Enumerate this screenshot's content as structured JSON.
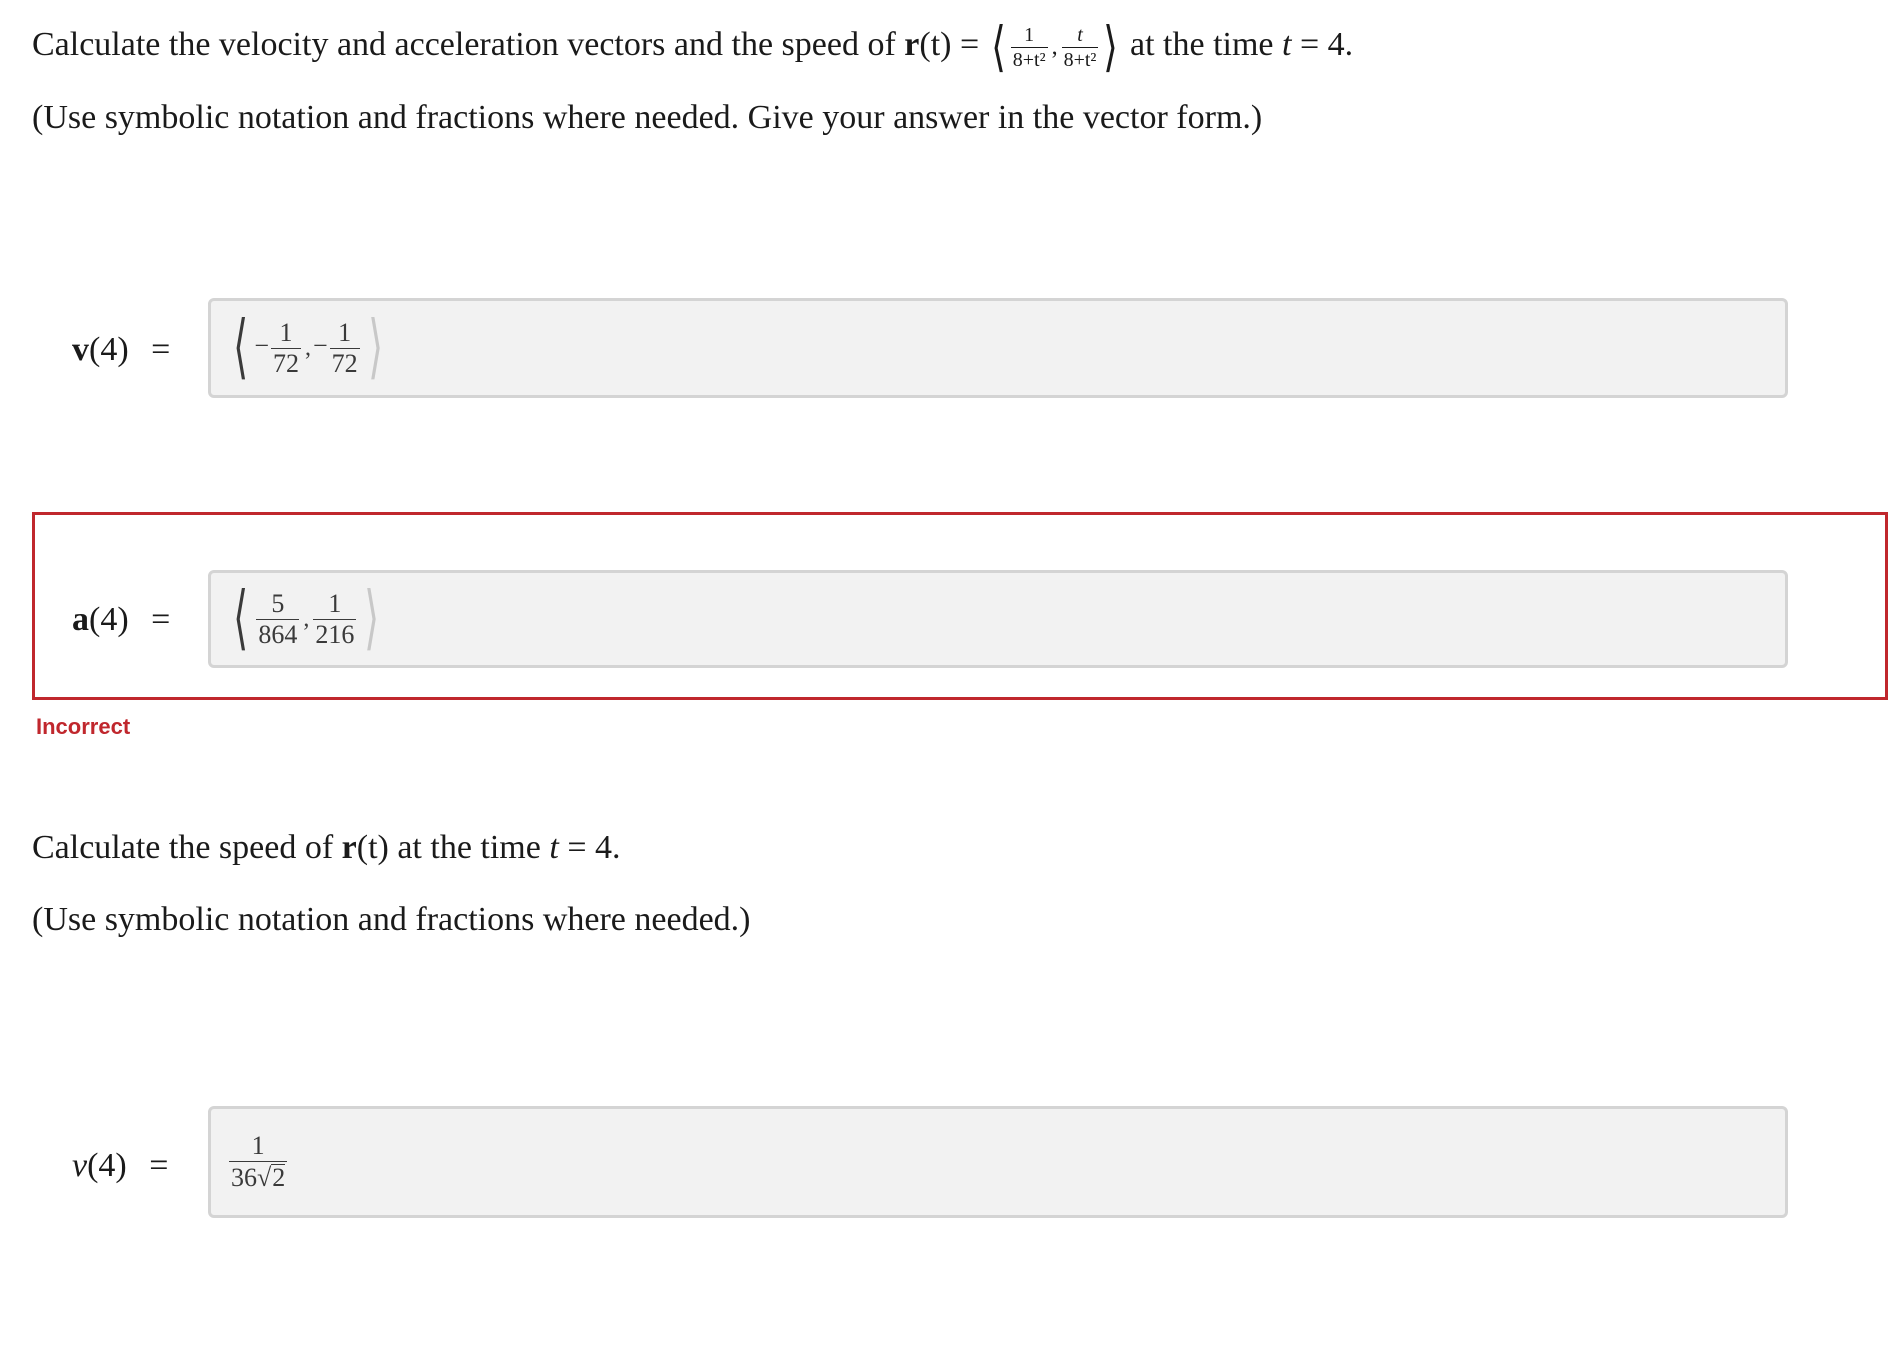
{
  "question1": {
    "prefix": "Calculate the velocity and acceleration vectors and the speed of",
    "r_symbol": "r",
    "r_arg": "(t)",
    "equals": "=",
    "frac1_num": "1",
    "frac1_den": "8+t²",
    "frac2_num": "t",
    "frac2_den": "8+t²",
    "suffix_a": "at the time",
    "t_var": "t",
    "suffix_b": "= 4."
  },
  "note1": "(Use symbolic notation and fractions where needed. Give your answer in the vector form.)",
  "velocity": {
    "label_sym": "v",
    "label_arg": "(4)",
    "equals": "=",
    "c1_sign": "−",
    "c1_num": "1",
    "c1_den": "72",
    "c2_sign": "−",
    "c2_num": "1",
    "c2_den": "72"
  },
  "acceleration": {
    "label_sym": "a",
    "label_arg": "(4)",
    "equals": "=",
    "c1_num": "5",
    "c1_den": "864",
    "c2_num": "1",
    "c2_den": "216",
    "status": "Incorrect"
  },
  "question2": {
    "prefix": "Calculate the speed of",
    "r_symbol": "r",
    "r_arg": "(t)",
    "suffix_a": "at the time",
    "t_var": "t",
    "suffix_b": "= 4."
  },
  "note2": "(Use symbolic notation and fractions where needed.)",
  "speed": {
    "label_sym": "v",
    "label_arg": "(4)",
    "equals": "=",
    "num": "1",
    "den_coef": "36",
    "den_radicand": "2"
  },
  "colors": {
    "error": "#c0272d",
    "box_bg": "#f2f2f2",
    "box_border": "#d4d4d4"
  }
}
